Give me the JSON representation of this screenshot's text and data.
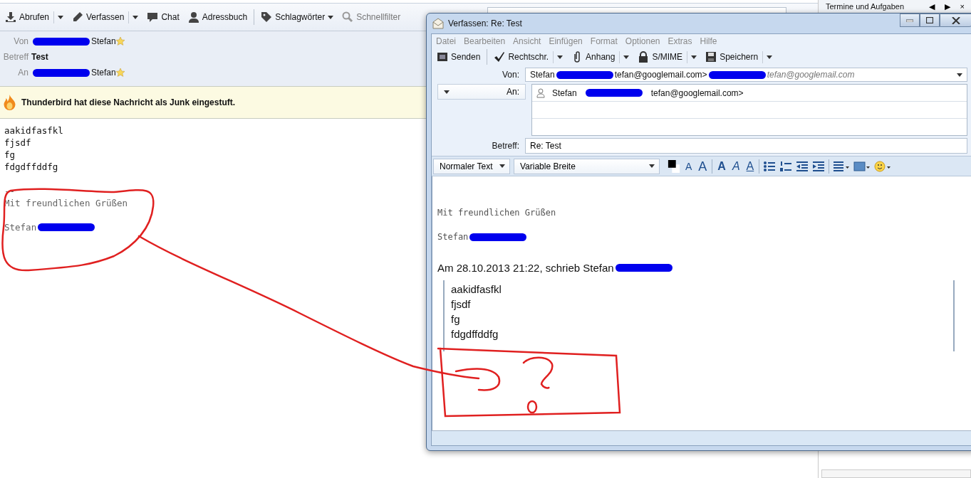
{
  "main_window": {
    "toolbar": [
      {
        "kind": "download",
        "label": "Abrufen",
        "menu": true,
        "disabled": false
      },
      {
        "kind": "pencil",
        "label": "Verfassen",
        "menu": true,
        "disabled": false
      },
      {
        "kind": "chat",
        "label": "Chat",
        "menu": false,
        "disabled": false
      },
      {
        "kind": "person",
        "label": "Adressbuch",
        "menu": false,
        "disabled": false
      },
      {
        "kind": "tag",
        "label": "Schlagwörter",
        "menu": true,
        "disabled": false
      },
      {
        "kind": "search",
        "label": "Schnellfilter",
        "menu": false,
        "disabled": true
      }
    ],
    "header": [
      {
        "label": "Von",
        "parts": [
          {
            "kind": "redaction"
          },
          {
            "kind": "text",
            "text": "Stefan"
          }
        ],
        "starred": true,
        "bold": false
      },
      {
        "label": "Betreff",
        "parts": [
          {
            "kind": "text",
            "text": "Test"
          }
        ],
        "starred": false,
        "bold": true
      },
      {
        "label": "An",
        "parts": [
          {
            "kind": "redaction"
          },
          {
            "kind": "text",
            "text": "Stefan"
          }
        ],
        "starred": true,
        "bold": false
      }
    ],
    "junk_notice": "Thunderbird hat diese Nachricht als Junk eingestuft.",
    "body_lines": [
      "aakidfasfkl",
      "fjsdf",
      "fg",
      "fdgdffddfg"
    ],
    "signature": {
      "separator": "--",
      "greeting": "Mit freundlichen Grüßen",
      "name_parts": [
        {
          "kind": "text",
          "text": "Stefan"
        },
        {
          "kind": "redaction"
        }
      ]
    }
  },
  "today_pane": {
    "title": "Termine und Aufgaben",
    "buttons": [
      "◀",
      "▶",
      "×"
    ]
  },
  "compose_window": {
    "title": "Verfassen: Re: Test",
    "menu": [
      "Datei",
      "Bearbeiten",
      "Ansicht",
      "Einfügen",
      "Format",
      "Optionen",
      "Extras",
      "Hilfe"
    ],
    "toolbar": [
      {
        "kind": "send",
        "label": "Senden",
        "menu": false
      },
      {
        "kind": "check",
        "label": "Rechtschr.",
        "menu": true
      },
      {
        "kind": "clip",
        "label": "Anhang",
        "menu": true
      },
      {
        "kind": "lock",
        "label": "S/MIME",
        "menu": true
      },
      {
        "kind": "disk",
        "label": "Speichern",
        "menu": true
      }
    ],
    "from": {
      "label": "Von:",
      "parts": [
        {
          "kind": "text",
          "text": "Stefan"
        },
        {
          "kind": "redaction"
        },
        {
          "kind": "text",
          "text": "tefan@googlemail.com>"
        },
        {
          "kind": "redaction"
        },
        {
          "kind": "hint",
          "text": "tefan@googlemail.com"
        }
      ]
    },
    "to": {
      "label": "An:",
      "recipients": [
        {
          "parts": [
            {
              "kind": "text",
              "text": "Stefan"
            },
            {
              "kind": "redaction"
            },
            {
              "kind": "text",
              "text": "tefan@googlemail.com>"
            }
          ]
        }
      ]
    },
    "subject": {
      "label": "Betreff:",
      "value": "Re: Test"
    },
    "paragraph_format": "Normaler Text",
    "font": "Variable Breite",
    "format_buttons": [
      {
        "kind": "color"
      },
      {
        "kind": "smaller",
        "label": "A"
      },
      {
        "kind": "larger",
        "label": "A"
      },
      {
        "kind": "bold",
        "label": "A"
      },
      {
        "kind": "italic",
        "label": "A"
      },
      {
        "kind": "underline",
        "label": "A"
      },
      {
        "kind": "bullets"
      },
      {
        "kind": "numbers"
      },
      {
        "kind": "outdent"
      },
      {
        "kind": "indent"
      },
      {
        "kind": "align"
      },
      {
        "kind": "image"
      },
      {
        "kind": "smiley"
      }
    ],
    "body": {
      "greeting": "Mit freundlichen Grüßen",
      "name_parts": [
        {
          "kind": "text",
          "text": "Stefan"
        },
        {
          "kind": "redaction"
        }
      ],
      "attribution_parts": [
        {
          "kind": "text",
          "text": "Am 28.10.2013 21:22, schrieb Stefan"
        },
        {
          "kind": "redaction"
        }
      ],
      "quote_lines": [
        "aakidfasfkl",
        "fjsdf",
        "fg",
        "fdgdffddfg"
      ]
    }
  }
}
